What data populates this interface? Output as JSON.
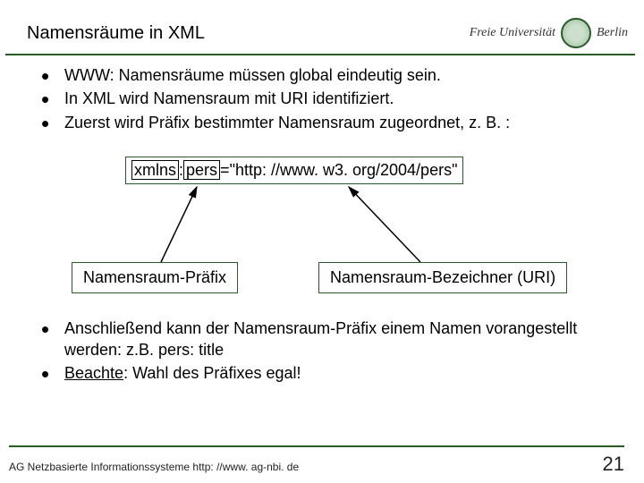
{
  "header": {
    "title": "Namensräume in XML",
    "logo_text": "Freie Universität",
    "logo_berlin": "Berlin"
  },
  "bullets1": {
    "b1": "WWW: Namensräume müssen global eindeutig sein.",
    "b2": "In XML wird Namensraum mit URI identifiziert.",
    "b3": "Zuerst wird Präfix bestimmter Namensraum zugeordnet, z. B. :"
  },
  "code": {
    "xmlns": "xmlns",
    "colon": ":",
    "pers": "pers",
    "equals": "=",
    "uri": "\"http: //www. w3. org/2004/pers\""
  },
  "labels": {
    "prefix": "Namensraum-Präfix",
    "uri": "Namensraum-Bezeichner (URI)"
  },
  "bullets2": {
    "b4": "Anschließend kann der Namensraum-Präfix einem Namen vorangestellt werden: z.B. pers: title",
    "b5_lead": "Beachte",
    "b5_rest": ": Wahl des Präfixes egal!"
  },
  "footer": {
    "text": "AG Netzbasierte Informationssysteme http: //www. ag-nbi. de",
    "page": "21"
  }
}
